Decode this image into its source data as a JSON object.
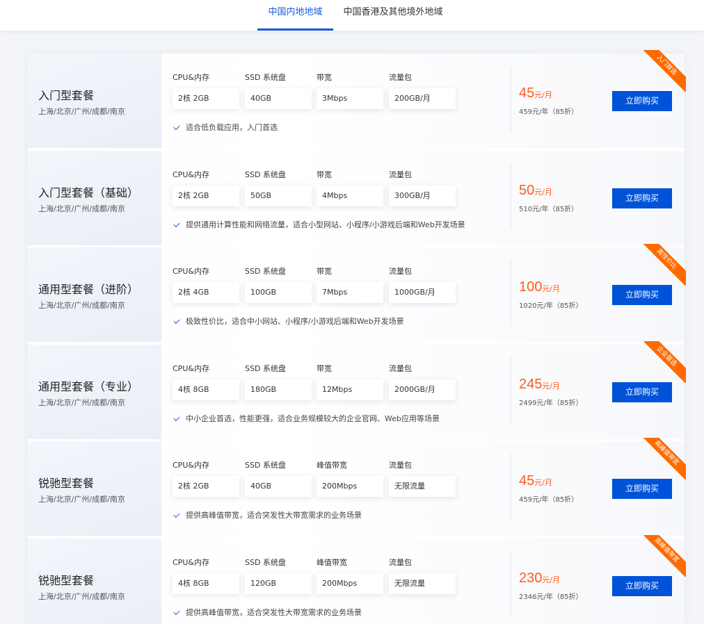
{
  "tabs": [
    {
      "label": "中国内地地域"
    },
    {
      "label": "中国香港及其他境外地域"
    }
  ],
  "colors": {
    "accent": "#0052d9",
    "price": "#ff5a1a",
    "ribbon": "#ff6a00"
  },
  "buy_label": "立即购买",
  "plans": [
    {
      "name": "入门型套餐",
      "regions": "上海/北京/广州/成都/南京",
      "labels": [
        "CPU&内存",
        "SSD 系统盘",
        "带宽",
        "流量包"
      ],
      "values": [
        "2核 2GB",
        "40GB",
        "3Mbps",
        "200GB/月"
      ],
      "desc": "适合低负载应用，入门首选",
      "price": "45",
      "unit": "元/月",
      "orig": "459元/年（85折）",
      "ribbon": "入门首选"
    },
    {
      "name": "入门型套餐（基础）",
      "regions": "上海/北京/广州/成都/南京",
      "labels": [
        "CPU&内存",
        "SSD 系统盘",
        "带宽",
        "流量包"
      ],
      "values": [
        "2核 2GB",
        "50GB",
        "4Mbps",
        "300GB/月"
      ],
      "desc": "提供通用计算性能和网络流量，适合小型网站、小程序/小游戏后端和Web开发场景",
      "price": "50",
      "unit": "元/月",
      "orig": "510元/年（85折）",
      "ribbon": ""
    },
    {
      "name": "通用型套餐（进阶）",
      "regions": "上海/北京/广州/成都/南京",
      "labels": [
        "CPU&内存",
        "SSD 系统盘",
        "带宽",
        "流量包"
      ],
      "values": [
        "2核 4GB",
        "100GB",
        "7Mbps",
        "1000GB/月"
      ],
      "desc": "极致性价比，适合中小网站、小程序/小游戏后端和Web开发场景",
      "price": "100",
      "unit": "元/月",
      "orig": "1020元/年（85折）",
      "ribbon": "高性价比"
    },
    {
      "name": "通用型套餐（专业）",
      "regions": "上海/北京/广州/成都/南京",
      "labels": [
        "CPU&内存",
        "SSD 系统盘",
        "带宽",
        "流量包"
      ],
      "values": [
        "4核 8GB",
        "180GB",
        "12Mbps",
        "2000GB/月"
      ],
      "desc": "中小企业首选，性能更强，适合业务规模较大的企业官网、Web应用等场景",
      "price": "245",
      "unit": "元/月",
      "orig": "2499元/年（85折）",
      "ribbon": "企业首选"
    },
    {
      "name": "锐驰型套餐",
      "regions": "上海/北京/广州/成都/南京",
      "labels": [
        "CPU&内存",
        "SSD 系统盘",
        "峰值带宽",
        "流量包"
      ],
      "values": [
        "2核 2GB",
        "40GB",
        "200Mbps",
        "无限流量"
      ],
      "desc": "提供高峰值带宽，适合突发性大带宽需求的业务场景",
      "price": "45",
      "unit": "元/月",
      "orig": "459元/年（85折）",
      "ribbon": "高峰值带宽"
    },
    {
      "name": "锐驰型套餐",
      "regions": "上海/北京/广州/成都/南京",
      "labels": [
        "CPU&内存",
        "SSD 系统盘",
        "峰值带宽",
        "流量包"
      ],
      "values": [
        "4核 8GB",
        "120GB",
        "200Mbps",
        "无限流量"
      ],
      "desc": "提供高峰值带宽，适合突发性大带宽需求的业务场景",
      "price": "230",
      "unit": "元/月",
      "orig": "2346元/年（85折）",
      "ribbon": "高峰值带宽"
    }
  ]
}
